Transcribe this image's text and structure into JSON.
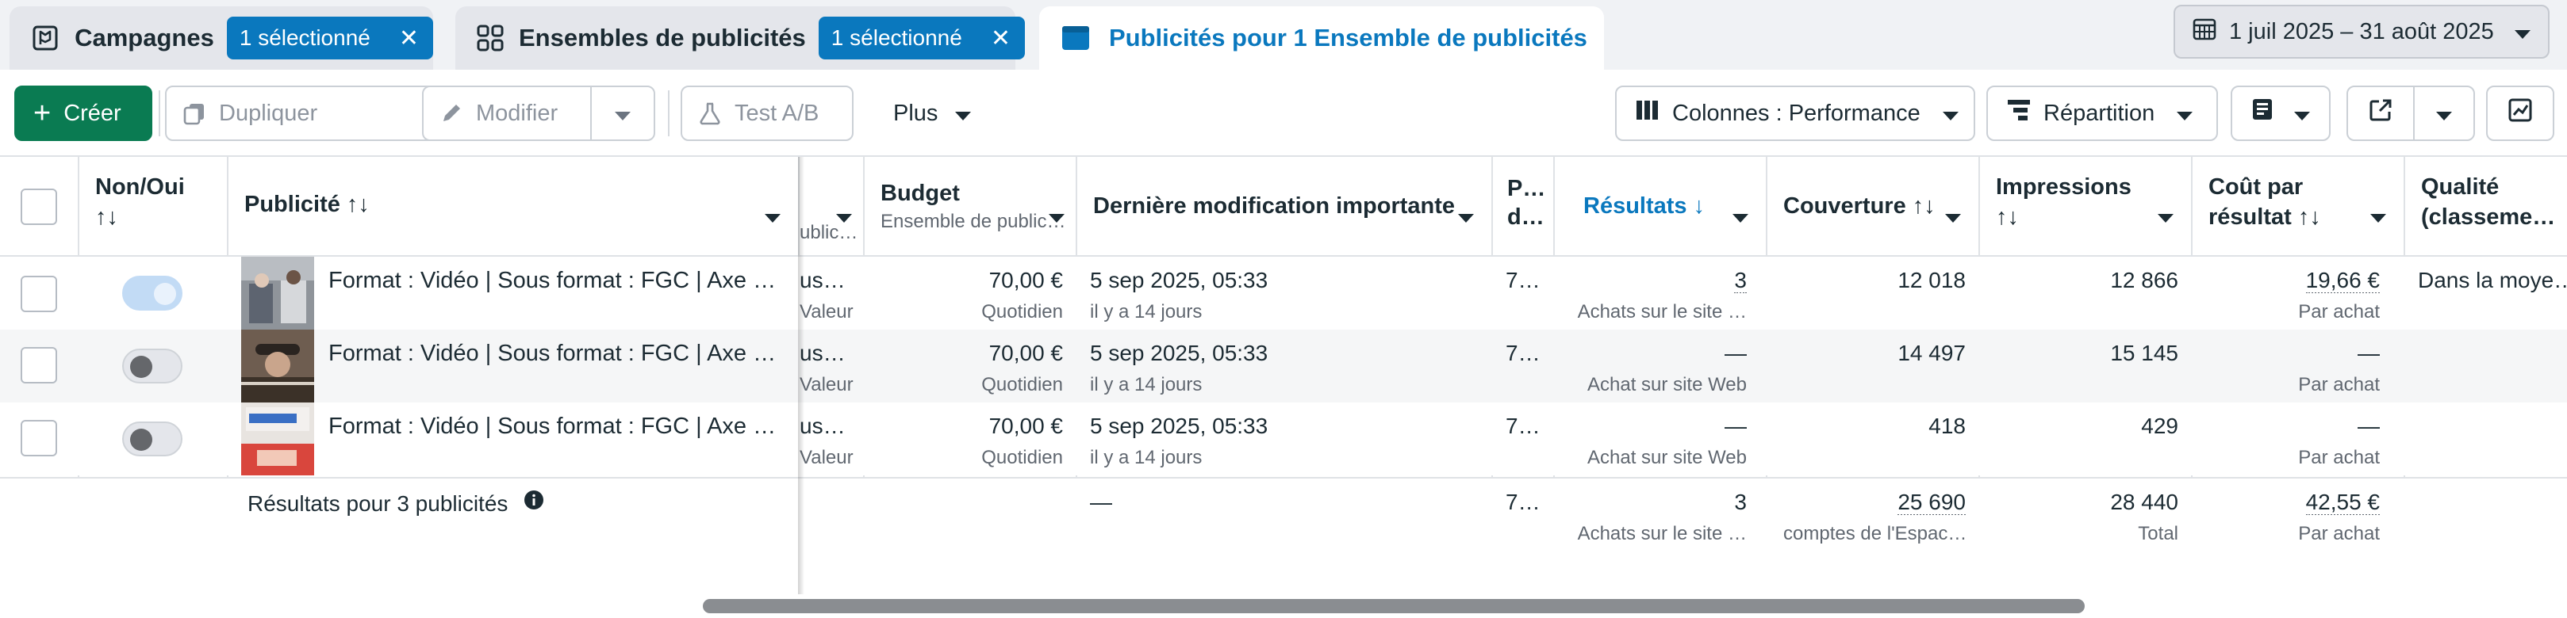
{
  "tabs": [
    {
      "label": "Campagnes",
      "selection": "1 sélectionné"
    },
    {
      "label": "Ensembles de publicités",
      "selection": "1 sélectionné"
    },
    {
      "label": "Publicités pour 1 Ensemble de publicités"
    }
  ],
  "date_range": "1 juil 2025 – 31 août 2025",
  "toolbar": {
    "create": "Créer",
    "duplicate": "Dupliquer",
    "edit": "Modifier",
    "abtest": "Test A/B",
    "more": "Plus",
    "columns": "Colonnes : Performance",
    "breakdown": "Répartition"
  },
  "colors": {
    "accent": "#0a78be",
    "create": "#0a7b52"
  },
  "headers": {
    "onoff": "Non/Oui",
    "onoff_sort": "↑↓",
    "ad": "Publicité ↑↓",
    "clipped_sub": "ublic…",
    "budget": "Budget",
    "budget_sub": "Ensemble de public…",
    "last_edit": "Dernière modification importante",
    "p_col_1": "P…",
    "p_col_2": "d…",
    "results": "Résultats ↓",
    "reach": "Couverture ↑↓",
    "impressions": "Impressions",
    "impressions_sort": "↑↓",
    "cpr": "Coût par",
    "cpr_2": "résultat ↑↓",
    "quality": "Qualité",
    "quality_2": "(classeme…"
  },
  "rows": [
    {
      "toggle_on": true,
      "name": "Format : Vidéo | Sous format : FGC | Axe : D…",
      "clip_top": "us…",
      "clip_bottom": "",
      "budget": "70,00 €",
      "budget_type": "Quotidien",
      "edit_date": "5 sep 2025, 05:33",
      "edit_ago": "il y a 14 jours",
      "p": "7…",
      "results": "3",
      "results_type": "Achats sur le site …",
      "reach": "12 018",
      "impressions": "12 866",
      "cpr": "19,66 €",
      "cpr_type": "Par achat",
      "quality": "Dans la moye…"
    },
    {
      "toggle_on": false,
      "name": "Format : Vidéo | Sous format : FGC | Axe : D…",
      "clip_top": "us…",
      "clip_bottom": "Valeur",
      "budget": "70,00 €",
      "budget_type": "Quotidien",
      "edit_date": "5 sep 2025, 05:33",
      "edit_ago": "il y a 14 jours",
      "p": "7…",
      "results": "—",
      "results_type": "Achat sur site Web",
      "reach": "14 497",
      "impressions": "15 145",
      "cpr": "—",
      "cpr_type": "Par achat",
      "quality": ""
    },
    {
      "toggle_on": false,
      "name": "Format : Vidéo | Sous format : FGC | Axe : D…",
      "clip_top": "us…",
      "clip_bottom": "Valeur",
      "budget": "70,00 €",
      "budget_type": "Quotidien",
      "edit_date": "5 sep 2025, 05:33",
      "edit_ago": "il y a 14 jours",
      "p": "7…",
      "results": "—",
      "results_type": "Achat sur site Web",
      "reach": "418",
      "impressions": "429",
      "cpr": "—",
      "cpr_type": "Par achat",
      "quality": ""
    }
  ],
  "row0_clip_bottom": "Valeur",
  "totals": {
    "label": "Résultats pour 3 publicités",
    "edit": "—",
    "p": "7…",
    "results": "3",
    "results_type": "Achats sur le site …",
    "reach": "25 690",
    "reach_type": "comptes de l'Espac…",
    "impressions": "28 440",
    "impressions_type": "Total",
    "cpr": "42,55 €",
    "cpr_type": "Par achat"
  }
}
